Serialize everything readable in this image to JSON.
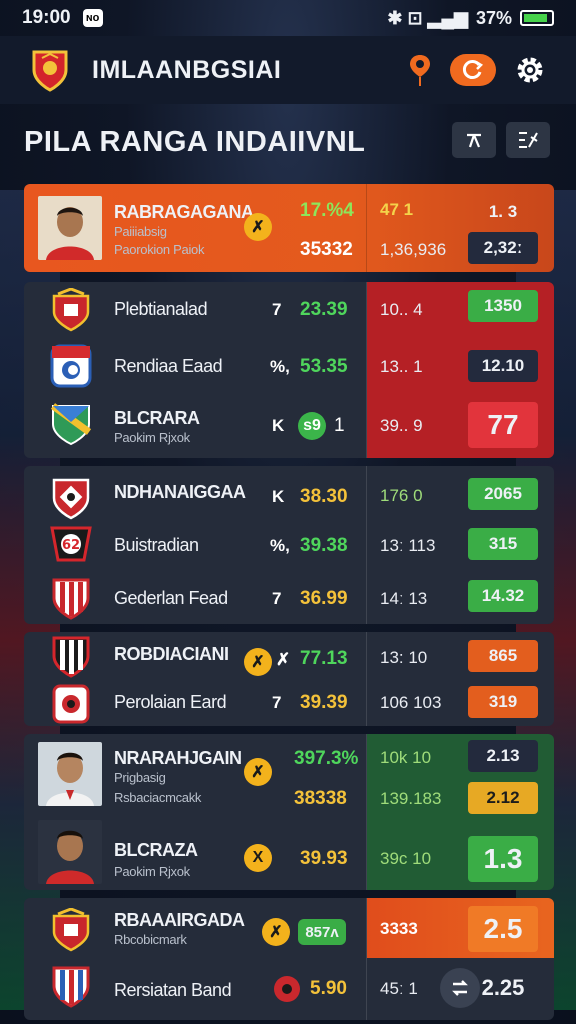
{
  "status": {
    "time": "19:00",
    "badge": "ɴᴏ",
    "icons": "✱ ⊡ ▂▄▆",
    "battery": "37%",
    "battery_level": 0.9
  },
  "header": {
    "title": "IMLAANBGSIAI",
    "icons": [
      "crest-logo",
      "location-pin-icon",
      "refresh-icon",
      "gear-icon"
    ]
  },
  "page": {
    "title": "PILA RANGA INDAIIVNL",
    "tools": [
      "pin-tool-icon",
      "edit-tool-icon"
    ]
  },
  "cards": [
    {
      "rows": [
        {
          "name": "RABRAGAGANA",
          "sub1": "Paiiiabsig",
          "sub2": "Paorokion Paiok",
          "coin": "✗",
          "stat_a": "17.%4",
          "stat_b": "35332",
          "mid_a": "47   1",
          "mid_b": "1,36,936",
          "box_a": "1. 3",
          "box_b": "2,32ː"
        }
      ]
    },
    {
      "rows": [
        {
          "name": "Plebtianalad",
          "sym": "7",
          "stat": "23.39",
          "mid": "10.. 4",
          "box": "1350"
        },
        {
          "name": "Rendiaa Eaad",
          "sym": "%,",
          "stat": "53.35",
          "mid": "13.. 1",
          "box": "12.10"
        },
        {
          "name": "BLCRARA",
          "sub": "Paokim Rjxok",
          "sym": "K",
          "coin": "s9",
          "after": "1",
          "mid": "39.. 9",
          "box": "77"
        }
      ]
    },
    {
      "rows": [
        {
          "name": "NDHANAIGGAA",
          "sym": "K",
          "stat": "38.30",
          "mid": "176  0",
          "box": "2065"
        },
        {
          "name": "Buistradian",
          "sym": "%,",
          "stat": "39.38",
          "mid": "13ː 113",
          "box": "315"
        },
        {
          "name": "Gederlan Fead",
          "sym": "7",
          "stat": "36.99",
          "mid": "14ː  13",
          "box": "14.32"
        }
      ]
    },
    {
      "rows": [
        {
          "name": "ROBDIACIANI",
          "coin": "✗",
          "sym": "✗",
          "stat": "77.13",
          "mid": "13: 10",
          "box": "865"
        },
        {
          "name": "Perolaian Eard",
          "sym": "7",
          "stat": "39.39",
          "mid": "106 103",
          "box": "319"
        }
      ]
    },
    {
      "rows": [
        {
          "name": "NRARAHJGAIN",
          "sub1": "Prigbasig",
          "sub2": "Rsbaciacmcakk",
          "coin": "✗",
          "stat_a": "397.3%",
          "stat_b": "38338",
          "mid_a": "10k  10",
          "mid_b": "139.183",
          "box_a": "2.13",
          "box_b": "2.12"
        },
        {
          "name": "BLCRAZA",
          "sub": "Paokim Rjxok",
          "coin": "X",
          "stat": "39.93",
          "mid": "39c 10",
          "box": "1.3"
        }
      ]
    },
    {
      "rows": [
        {
          "name": "RBAAAIRGADA",
          "sub": "Rbcobicmark",
          "coin": "✗",
          "pill": "857ʌ",
          "mid": "3333",
          "box": "2.5"
        },
        {
          "name": "Rersiatan Band",
          "stat": "5.90",
          "mid": "45ː  1",
          "box": "2.25"
        }
      ]
    }
  ],
  "colors": {
    "orange": "#e35e1e",
    "green": "#3aad46",
    "red": "#d8323a",
    "yellow": "#f4c23a",
    "accent_green_text": "#4fd65c"
  }
}
